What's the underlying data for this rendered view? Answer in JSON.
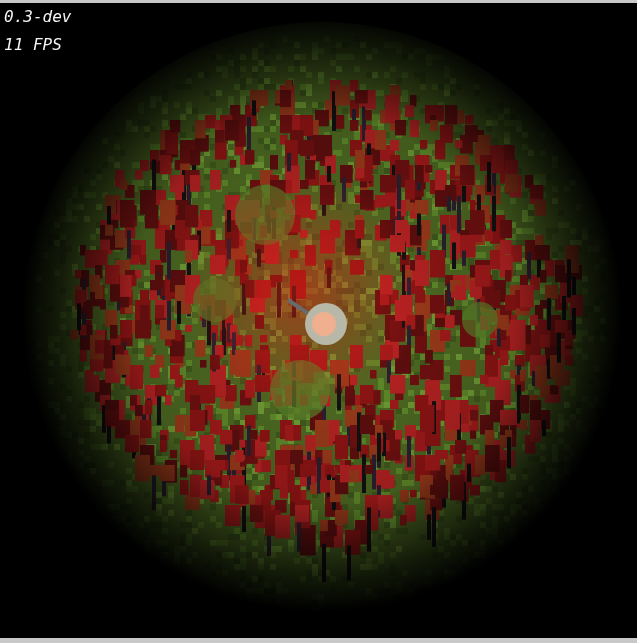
{
  "hud": {
    "version": "0.3-dev",
    "fps": "11 FPS"
  }
}
